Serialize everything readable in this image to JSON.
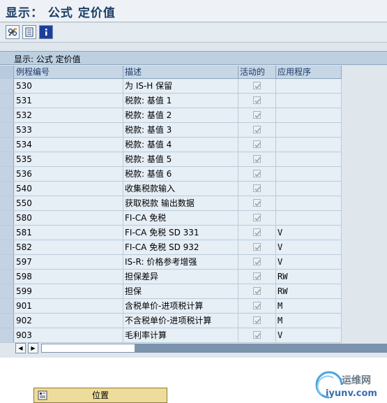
{
  "window": {
    "title": "显示： 公式 定价值"
  },
  "toolbar": {
    "buttons": [
      {
        "icon": "glasses-change-icon"
      },
      {
        "icon": "document-list-icon"
      },
      {
        "icon": "info-icon"
      }
    ]
  },
  "grid": {
    "title": "显示:  公式 定价值",
    "columns": [
      "例程编号",
      "描述",
      "活动的",
      "应用程序"
    ],
    "rows": [
      {
        "num": "530",
        "desc": "为 IS-H 保留",
        "active": true,
        "app": ""
      },
      {
        "num": "531",
        "desc": "税款: 基值 1",
        "active": true,
        "app": ""
      },
      {
        "num": "532",
        "desc": "税款: 基值 2",
        "active": true,
        "app": ""
      },
      {
        "num": "533",
        "desc": "税款: 基值 3",
        "active": true,
        "app": ""
      },
      {
        "num": "534",
        "desc": "税款: 基值 4",
        "active": true,
        "app": ""
      },
      {
        "num": "535",
        "desc": "税款: 基值 5",
        "active": true,
        "app": ""
      },
      {
        "num": "536",
        "desc": "税款: 基值 6",
        "active": true,
        "app": ""
      },
      {
        "num": "540",
        "desc": "收集税款输入",
        "active": true,
        "app": ""
      },
      {
        "num": "550",
        "desc": "获取税款 输出数据",
        "active": true,
        "app": ""
      },
      {
        "num": "580",
        "desc": "FI-CA 免税",
        "active": true,
        "app": ""
      },
      {
        "num": "581",
        "desc": "FI-CA 免税 SD 331",
        "active": true,
        "app": "V"
      },
      {
        "num": "582",
        "desc": "FI-CA 免税 SD 932",
        "active": true,
        "app": "V"
      },
      {
        "num": "597",
        "desc": "IS-R: 价格参考增强",
        "active": true,
        "app": "V"
      },
      {
        "num": "598",
        "desc": "担保差异",
        "active": true,
        "app": "RW"
      },
      {
        "num": "599",
        "desc": "担保",
        "active": true,
        "app": "RW"
      },
      {
        "num": "901",
        "desc": "含税单价-进项税计算",
        "active": true,
        "app": "M"
      },
      {
        "num": "902",
        "desc": "不含税单价-进项税计算",
        "active": true,
        "app": "M"
      },
      {
        "num": "903",
        "desc": "毛利率计算",
        "active": true,
        "app": "V"
      }
    ]
  },
  "footer": {
    "position_button": "位置"
  },
  "watermark": {
    "name": "运维网",
    "url": "iyunv.com"
  }
}
